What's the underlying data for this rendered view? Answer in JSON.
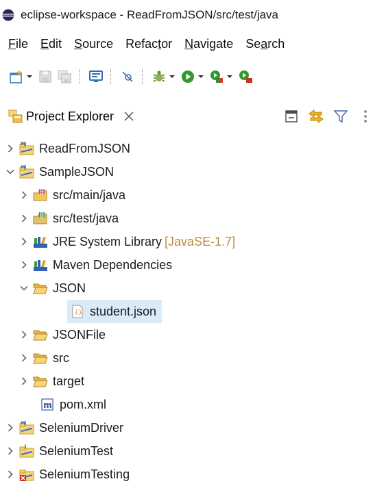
{
  "window": {
    "title": "eclipse-workspace - ReadFromJSON/src/test/java"
  },
  "menubar": {
    "items": [
      {
        "mnemonic": "F",
        "rest": "ile"
      },
      {
        "mnemonic": "E",
        "rest": "dit"
      },
      {
        "mnemonic": "S",
        "rest": "ource"
      },
      {
        "pre": "Refac",
        "mnemonic": "t",
        "rest": "or"
      },
      {
        "mnemonic": "N",
        "rest": "avigate"
      },
      {
        "pre": "Se",
        "mnemonic": "a",
        "rest": "rch"
      }
    ]
  },
  "view": {
    "tab_label": "Project Explorer"
  },
  "tree": [
    {
      "label": "ReadFromJSON",
      "depth": 0,
      "expanded": false,
      "icon": "maven-project-icon"
    },
    {
      "label": "SampleJSON",
      "depth": 0,
      "expanded": true,
      "icon": "maven-project-icon"
    },
    {
      "label": "src/main/java",
      "depth": 1,
      "expanded": false,
      "icon": "source-folder-icon"
    },
    {
      "label": "src/test/java",
      "depth": 1,
      "expanded": false,
      "icon": "source-folder-icon"
    },
    {
      "label": "JRE System Library",
      "decoration": "[JavaSE-1.7]",
      "depth": 1,
      "expanded": false,
      "icon": "library-icon"
    },
    {
      "label": "Maven Dependencies",
      "depth": 1,
      "expanded": false,
      "icon": "library-icon"
    },
    {
      "label": "JSON",
      "depth": 1,
      "expanded": true,
      "icon": "folder-icon"
    },
    {
      "label": "student.json",
      "depth": 2,
      "leaf": true,
      "selected": true,
      "icon": "json-file-icon"
    },
    {
      "label": "JSONFile",
      "depth": 1,
      "expanded": false,
      "icon": "folder-icon"
    },
    {
      "label": "src",
      "depth": 1,
      "expanded": false,
      "icon": "folder-icon"
    },
    {
      "label": "target",
      "depth": 1,
      "expanded": false,
      "icon": "folder-icon"
    },
    {
      "label": "pom.xml",
      "depth": 1,
      "leaf": true,
      "icon": "maven-pom-icon"
    },
    {
      "label": "SeleniumDriver",
      "depth": 0,
      "expanded": false,
      "icon": "maven-project-icon"
    },
    {
      "label": "SeleniumTest",
      "depth": 0,
      "expanded": false,
      "icon": "java-project-icon"
    },
    {
      "label": "SeleniumTesting",
      "depth": 0,
      "expanded": false,
      "icon": "java-project-error-icon"
    }
  ]
}
